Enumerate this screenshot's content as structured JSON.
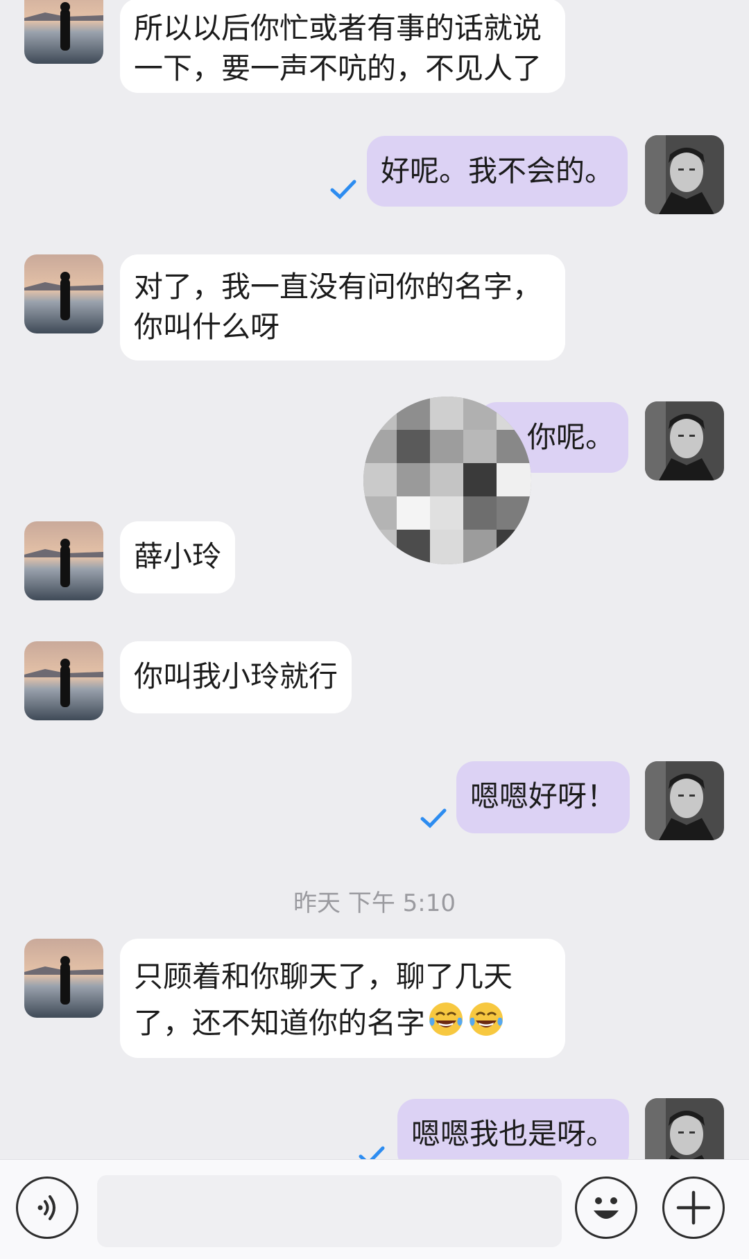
{
  "messages": [
    {
      "side": "in",
      "lines": [
        "所以以后你忙或者有事的话就说",
        "一下，要一声不吭的，不见人了"
      ]
    },
    {
      "side": "out",
      "text": "好呢。我不会的。"
    },
    {
      "side": "in",
      "lines": [
        "对了，我一直没有问你的名字，",
        "你叫什么呀"
      ]
    },
    {
      "side": "out",
      "text": "你呢。"
    },
    {
      "side": "in",
      "text": "薛小玲"
    },
    {
      "side": "in",
      "text": "你叫我小玲就行"
    },
    {
      "side": "out",
      "text": "嗯嗯好呀！"
    },
    {
      "side": "in",
      "lines": [
        "只顾着和你聊天了，聊了几天",
        "了，还不知道你的名字"
      ],
      "emoji": "tears-of-joy-emoji"
    },
    {
      "side": "out",
      "text": "嗯嗯我也是呀。"
    }
  ],
  "timestamp": "昨天 下午 5:10",
  "colors": {
    "background": "#ededf0",
    "incoming_bubble": "#ffffff",
    "outgoing_bubble": "#dcd2f4",
    "read_check": "#2d8cf0"
  },
  "input_bar": {
    "left_icon": "voice-icon",
    "right_icons": [
      "emoji-icon",
      "plus-icon"
    ]
  }
}
